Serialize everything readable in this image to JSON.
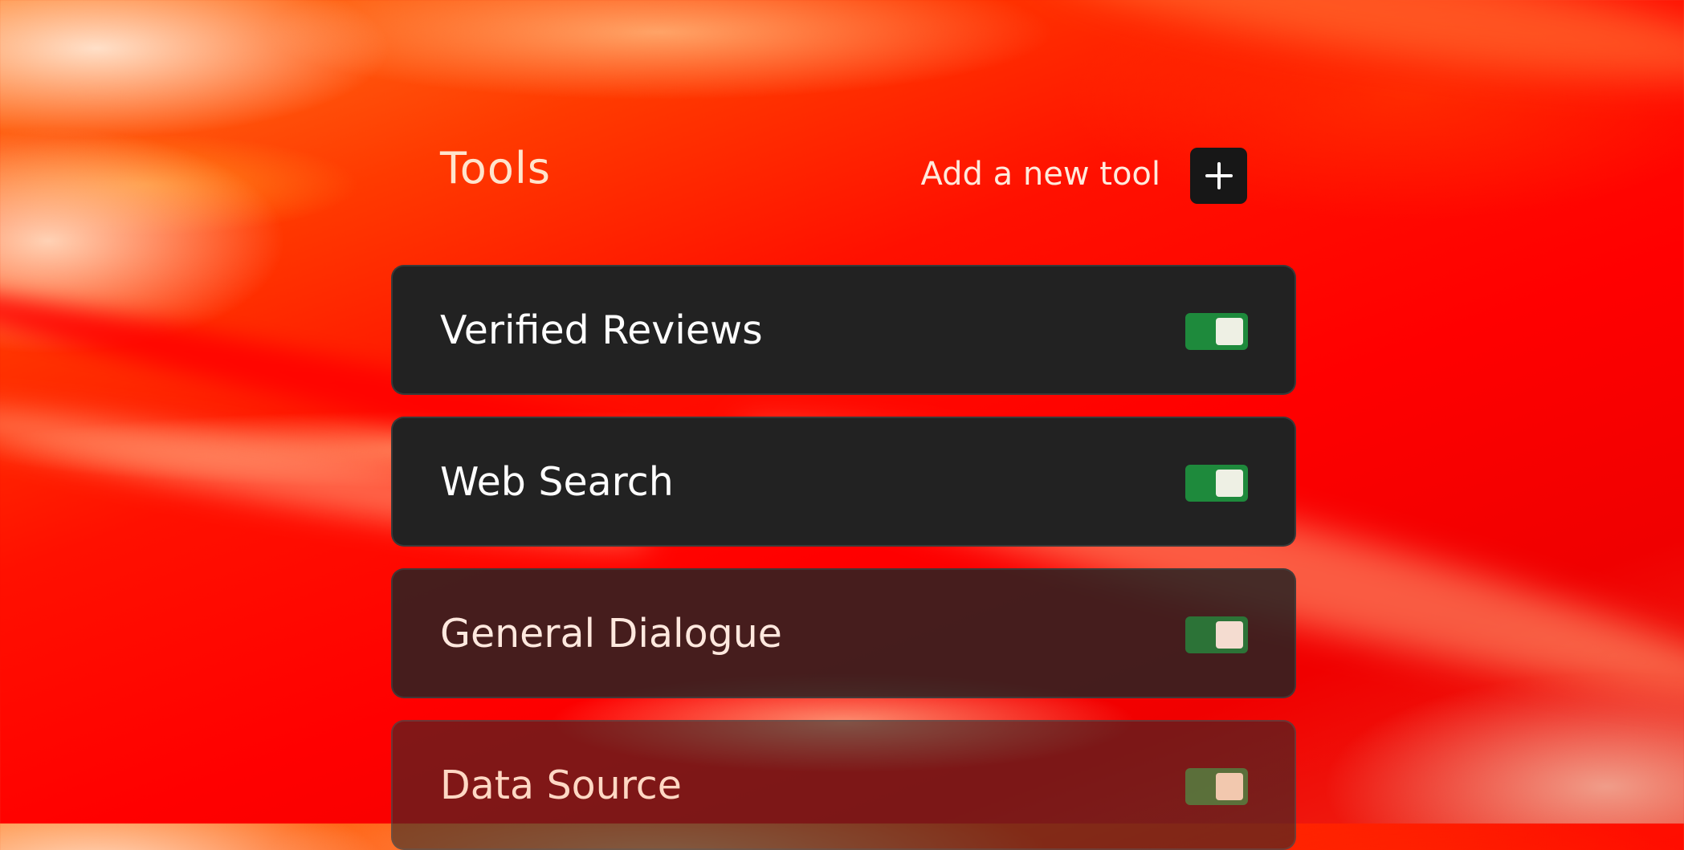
{
  "header": {
    "title": "Tools",
    "add_label": "Add a new tool",
    "add_button_icon": "plus-icon"
  },
  "tools": [
    {
      "label": "Verified Reviews",
      "enabled": true
    },
    {
      "label": "Web Search",
      "enabled": true
    },
    {
      "label": "General Dialogue",
      "enabled": true
    },
    {
      "label": "Data Source",
      "enabled": true
    }
  ],
  "colors": {
    "card_background": "#222222",
    "toggle_on": "#1e8a3c",
    "add_button_background": "#171717",
    "background_primary": "#ff1000",
    "background_accent": "#ff7a1c"
  }
}
